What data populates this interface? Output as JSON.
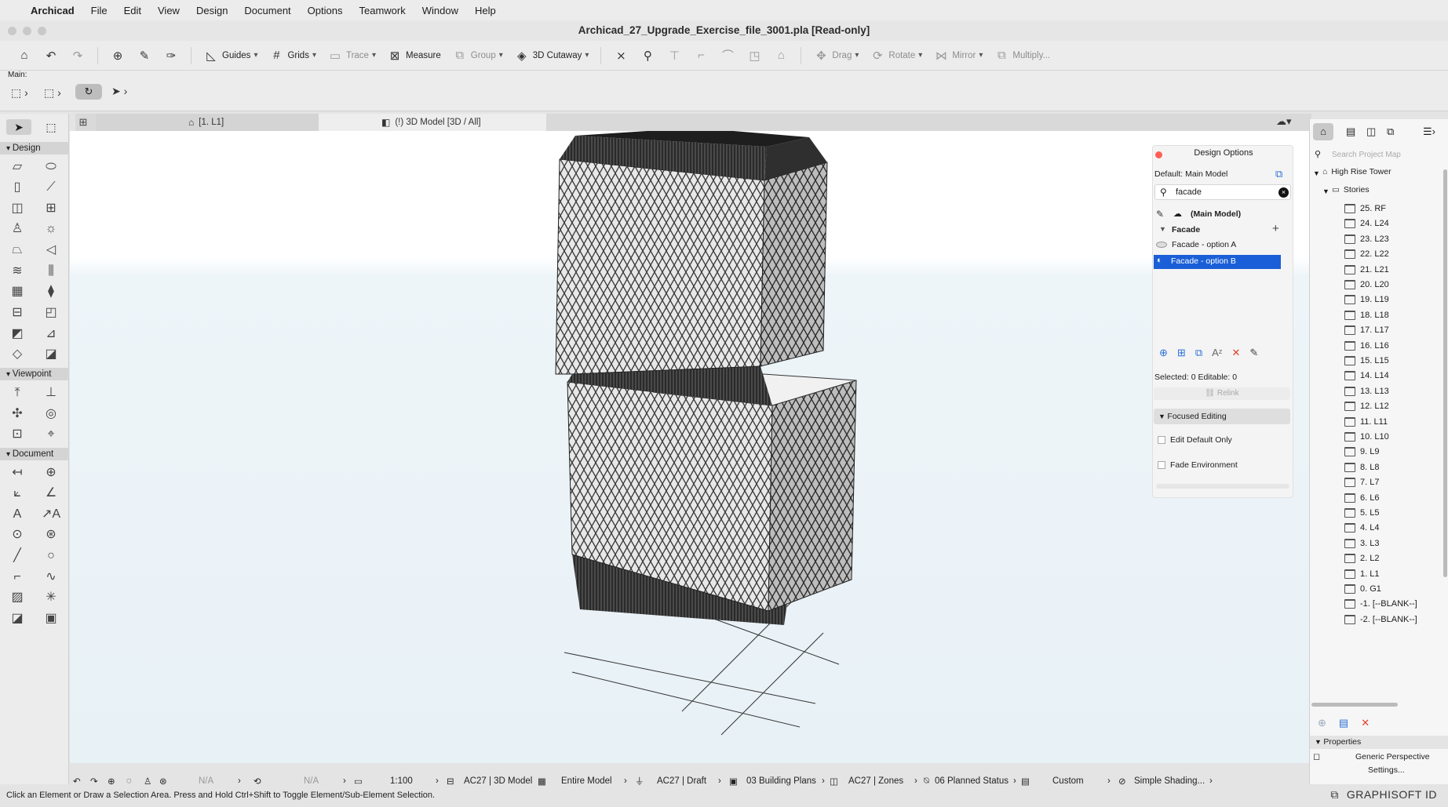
{
  "menubar": {
    "app": "Archicad",
    "items": [
      "File",
      "Edit",
      "View",
      "Design",
      "Document",
      "Options",
      "Teamwork",
      "Window",
      "Help"
    ]
  },
  "window": {
    "title": "Archicad_27_Upgrade_Exercise_file_3001.pla [Read-only]"
  },
  "toolbar": {
    "guides": "Guides",
    "grids": "Grids",
    "trace": "Trace",
    "measure": "Measure",
    "group": "Group",
    "cutaway": "3D Cutaway",
    "drag": "Drag",
    "rotate": "Rotate",
    "mirror": "Mirror",
    "multiply": "Multiply..."
  },
  "infobar": {
    "main_label": "Main:"
  },
  "tabs": {
    "floor": "[1. L1]",
    "model": "(!) 3D Model [3D / All]"
  },
  "toolbox": {
    "design": "Design",
    "viewpoint": "Viewpoint",
    "document": "Document"
  },
  "design_options": {
    "title": "Design Options",
    "default_label": "Default: Main Model",
    "search": "facade",
    "main_model": "(Main Model)",
    "set_name": "Facade",
    "option_a": "Facade - option A",
    "option_b": "Facade - option B",
    "selected": "Selected: 0 Editable: 0",
    "relink": "Relink",
    "focused_editing": "Focused Editing",
    "edit_default_only": "Edit Default Only",
    "fade_environment": "Fade Environment"
  },
  "navigator": {
    "search_placeholder": "Search Project Map",
    "project": "High Rise Tower",
    "stories_label": "Stories",
    "stories": [
      "25. RF",
      "24. L24",
      "23. L23",
      "22. L22",
      "21. L21",
      "20. L20",
      "19. L19",
      "18. L18",
      "17. L17",
      "16. L16",
      "15. L15",
      "14. L14",
      "13. L13",
      "12. L12",
      "11. L11",
      "10. L10",
      "9. L9",
      "8. L8",
      "7. L7",
      "6. L6",
      "5. L5",
      "4. L4",
      "3. L3",
      "2. L2",
      "1. L1",
      "0. G1",
      "-1. [--BLANK--]",
      "-2. [--BLANK--]"
    ],
    "properties_label": "Properties",
    "properties_value": "Generic Perspective",
    "settings": "Settings..."
  },
  "status": {
    "na1": "N/A",
    "na2": "N/A",
    "scale": "1:100",
    "model_view": "AC27 | 3D Model",
    "scope": "Entire Model",
    "pen": "AC27 | Draft",
    "layer_combo": "03 Building Plans",
    "zones": "AC27 | Zones",
    "planned": "06 Planned Status",
    "custom": "Custom",
    "shading": "Simple Shading..."
  },
  "hint": "Click an Element or Draw a Selection Area. Press and Hold Ctrl+Shift to Toggle Element/Sub-Element Selection.",
  "brand": "GRAPHISOFT ID"
}
